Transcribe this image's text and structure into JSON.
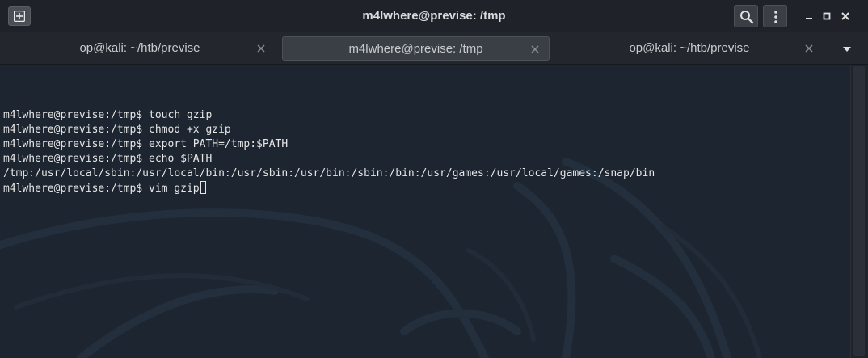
{
  "window": {
    "title": "m4lwhere@previse: /tmp"
  },
  "icons": {
    "new_tab": "new-tab-icon",
    "search": "search-icon",
    "menu": "kebab-menu-icon",
    "minimize": "minimize-icon",
    "maximize": "maximize-icon",
    "close": "close-icon",
    "tab_close": "close-icon",
    "tabs_dropdown": "chevron-down-icon"
  },
  "tabs": [
    {
      "label": "op@kali: ~/htb/previse",
      "active": false
    },
    {
      "label": "m4lwhere@previse: /tmp",
      "active": true
    },
    {
      "label": "op@kali: ~/htb/previse",
      "active": false
    }
  ],
  "terminal": {
    "lines": [
      "m4lwhere@previse:/tmp$ touch gzip",
      "m4lwhere@previse:/tmp$ chmod +x gzip",
      "m4lwhere@previse:/tmp$ export PATH=/tmp:$PATH",
      "m4lwhere@previse:/tmp$ echo $PATH",
      "/tmp:/usr/local/sbin:/usr/local/bin:/usr/sbin:/usr/bin:/sbin:/bin:/usr/games:/usr/local/games:/snap/bin",
      "m4lwhere@previse:/tmp$ vim gzip"
    ]
  },
  "colors": {
    "terminal_bg": "#1c2530",
    "text": "#e6e6e6",
    "titlebar_bg": "#1f2329",
    "active_tab_bg": "#3a3f46"
  }
}
